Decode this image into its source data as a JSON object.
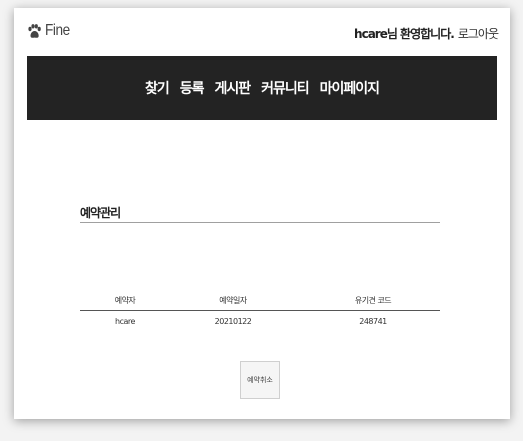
{
  "header": {
    "logo_text": "Fine",
    "welcome": "hcare님 환영합니다.",
    "logout": "로그아웃"
  },
  "nav": {
    "items": [
      "찾기",
      "등록",
      "게시판",
      "커뮤니티",
      "마이페이지"
    ]
  },
  "section": {
    "title": "예약관리"
  },
  "table": {
    "headers": [
      "예약자",
      "예약일자",
      "유기견 코드"
    ],
    "rows": [
      [
        "hcare",
        "20210122",
        "248741"
      ]
    ]
  },
  "actions": {
    "cancel_label": "예약취소"
  }
}
